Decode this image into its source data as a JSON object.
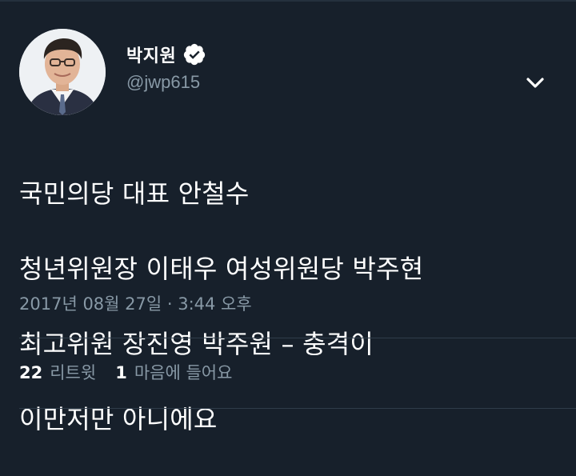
{
  "user": {
    "display_name": "박지원",
    "handle": "@jwp615",
    "verified_icon": "verified-badge-icon"
  },
  "tweet": {
    "lines": [
      "국민의당 대표 안철수",
      "청년위원장 이태우 여성위원당  박주현",
      "최고위원 장진영 박주원 – 충격이",
      "이만저만 아니에요"
    ],
    "timestamp": "2017년 08월 27일 · 3:44 오후"
  },
  "stats": {
    "retweets_count": "22",
    "retweets_label": "리트윗",
    "likes_count": "1",
    "likes_label": "마음에 들어요"
  },
  "colors": {
    "background": "#17202b",
    "secondary_text": "#8899a6",
    "divider": "#2f3c4a"
  },
  "icons": {
    "menu": "chevron-down-icon"
  }
}
